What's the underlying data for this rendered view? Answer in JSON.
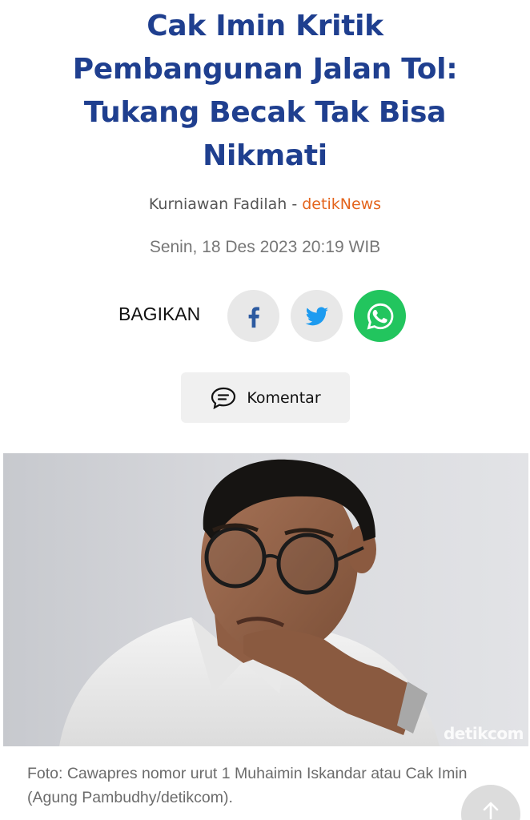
{
  "article": {
    "headline": "Cak Imin Kritik Pembangunan Jalan Tol: Tukang Becak Tak Bisa Nikmati",
    "author": "Kurniawan Fadilah",
    "separator": " - ",
    "source": "detikNews",
    "date": "Senin, 18 Des 2023 20:19 WIB"
  },
  "share": {
    "label": "BAGIKAN",
    "buttons": [
      {
        "network": "facebook",
        "icon": "facebook-icon",
        "color": "#2c5aa0"
      },
      {
        "network": "twitter",
        "icon": "twitter-icon",
        "color": "#1d9bf0"
      },
      {
        "network": "whatsapp",
        "icon": "whatsapp-icon",
        "color": "#22c55e"
      }
    ]
  },
  "comment": {
    "label": "Komentar",
    "icon": "comment-icon"
  },
  "photo": {
    "watermark": "detikcom",
    "caption": "Foto: Cawapres nomor urut 1 Muhaimin Iskandar atau Cak Imin (Agung Pambudhy/detikcom)."
  },
  "scroll_top": {
    "icon": "arrow-up-icon"
  },
  "colors": {
    "headline": "#1f3f8f",
    "source": "#e4641c",
    "whatsapp": "#22c55e"
  }
}
